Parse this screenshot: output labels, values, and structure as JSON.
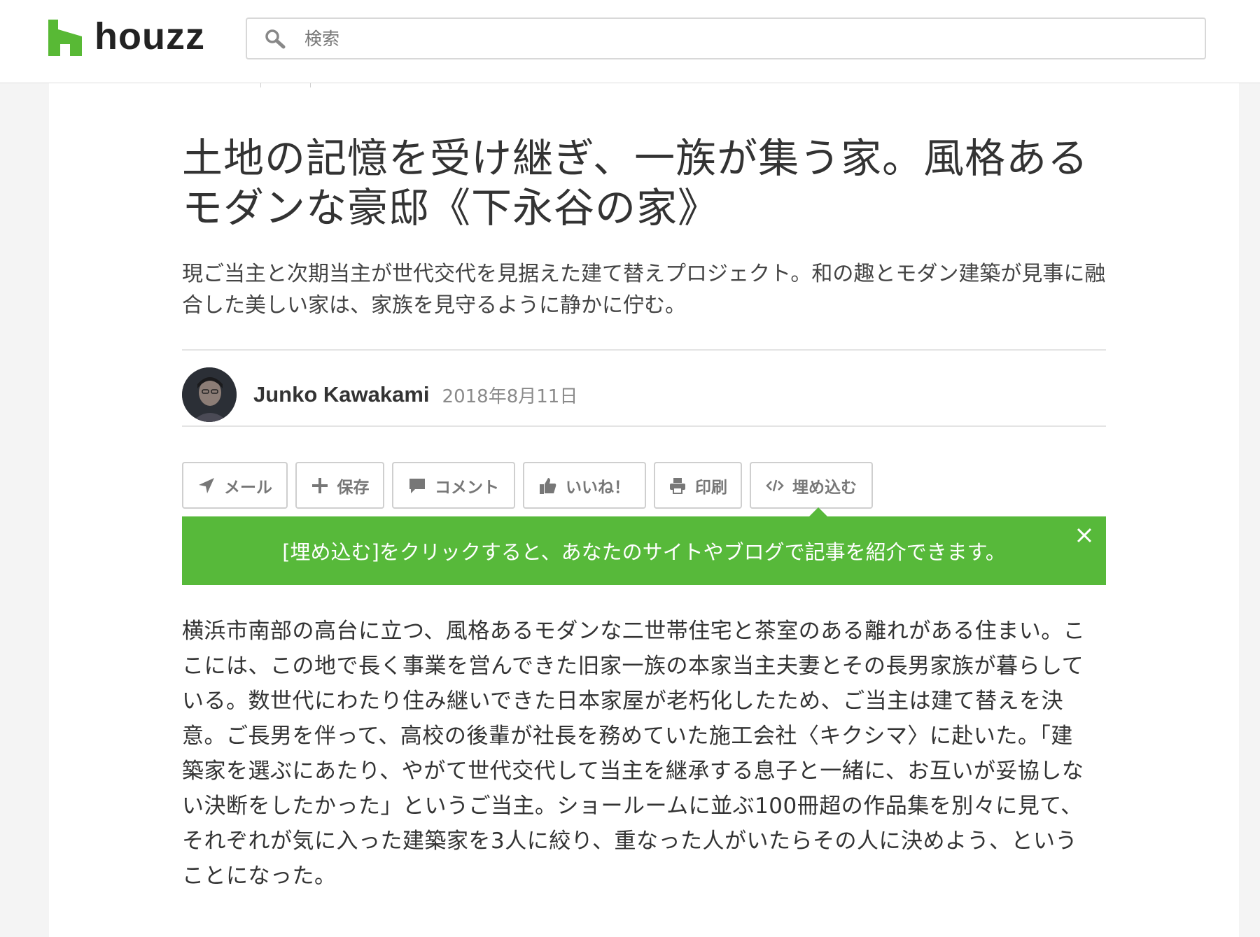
{
  "header": {
    "logo_text": "houzz",
    "search_placeholder": "検索"
  },
  "article": {
    "title": "土地の記憶を受け継ぎ、一族が集う家。風格あるモダンな豪邸《下永谷の家》",
    "subtitle": "現ご当主と次期当主が世代交代を見据えた建て替えプロジェクト。和の趣とモダン建築が見事に融合した美しい家は、家族を見守るように静かに佇む。",
    "author": {
      "name": "Junko Kawakami",
      "date": "2018年8月11日"
    },
    "actions": [
      {
        "label": "メール",
        "icon": "send-icon"
      },
      {
        "label": "保存",
        "icon": "plus-icon"
      },
      {
        "label": "コメント",
        "icon": "comment-icon"
      },
      {
        "label": "いいね！",
        "icon": "thumbs-up-icon"
      },
      {
        "label": "印刷",
        "icon": "print-icon"
      },
      {
        "label": "埋め込む",
        "icon": "code-icon"
      }
    ],
    "embed_banner": {
      "text": "[埋め込む]をクリックすると、あなたのサイトやブログで記事を紹介できます。",
      "close_icon": "close-icon"
    },
    "body": "横浜市南部の高台に立つ、風格あるモダンな二世帯住宅と茶室のある離れがある住まい。ここには、この地で長く事業を営んできた旧家一族の本家当主夫妻とその長男家族が暮らしている。数世代にわたり住み継いできた日本家屋が老朽化したため、ご当主は建て替えを決意。ご長男を伴って、高校の後輩が社長を務めていた施工会社〈キクシマ〉に赴いた。「建築家を選ぶにあたり、やがて世代交代して当主を継承する息子と一緒に、お互いが妥協しない決断をしたかった」というご当主。ショールームに並ぶ100冊超の作品集を別々に見て、それぞれが気に入った建築家を3人に絞り、重なった人がいたらその人に決めよう、ということになった。"
  },
  "colors": {
    "brand_green": "#57b93a",
    "text": "#333333",
    "muted": "#8a8a8a"
  }
}
